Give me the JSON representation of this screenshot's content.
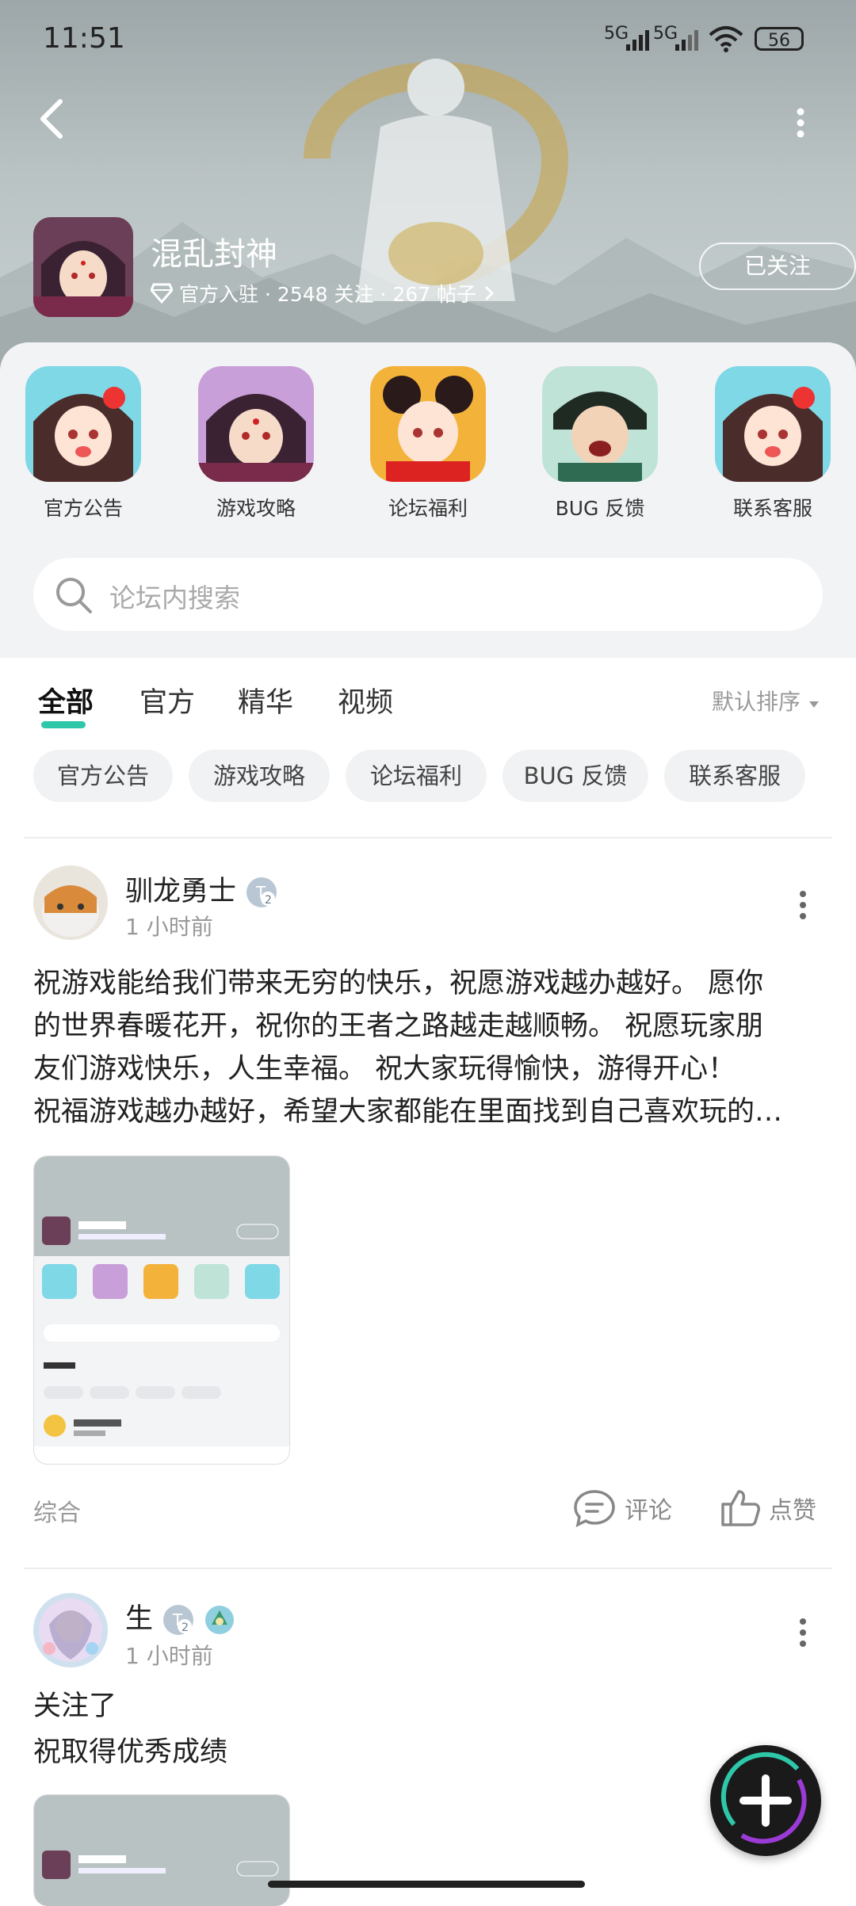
{
  "status_bar": {
    "time": "11:51",
    "signal1": "5G",
    "signal2": "5G",
    "battery": "56"
  },
  "forum": {
    "title": "混乱封神",
    "official": "官方入驻",
    "meta": "· 2548 关注 · 267 帖子",
    "follow_label": "已关注"
  },
  "quick_links": [
    {
      "label": "官方公告"
    },
    {
      "label": "游戏攻略"
    },
    {
      "label": "论坛福利"
    },
    {
      "label": "BUG 反馈"
    },
    {
      "label": "联系客服"
    }
  ],
  "search": {
    "placeholder": "论坛内搜索"
  },
  "tabs": [
    {
      "label": "全部"
    },
    {
      "label": "官方"
    },
    {
      "label": "精华"
    },
    {
      "label": "视频"
    }
  ],
  "sort_label": "默认排序",
  "chips": [
    {
      "label": "官方公告"
    },
    {
      "label": "游戏攻略"
    },
    {
      "label": "论坛福利"
    },
    {
      "label": "BUG 反馈"
    },
    {
      "label": "联系客服"
    }
  ],
  "posts": [
    {
      "author": "驯龙勇士",
      "time": "1 小时前",
      "lines": [
        "祝游戏能给我们带来无穷的快乐，祝愿游戏越办越好。 愿你",
        "的世界春暖花开，祝你的王者之路越走越顺畅。 祝愿玩家朋",
        "友们游戏快乐，人生幸福。 祝大家玩得愉快，游得开心！",
        "祝福游戏越办越好，希望大家都能在里面找到自己喜欢玩的…"
      ],
      "category": "综合",
      "comment_label": "评论",
      "like_label": "点赞"
    },
    {
      "author": "生",
      "time": "1 小时前",
      "lines": [
        "关注了",
        "祝取得优秀成绩"
      ]
    }
  ],
  "colors": {
    "accent": "#2ec7a9",
    "text": "#222222",
    "muted": "#999999"
  }
}
